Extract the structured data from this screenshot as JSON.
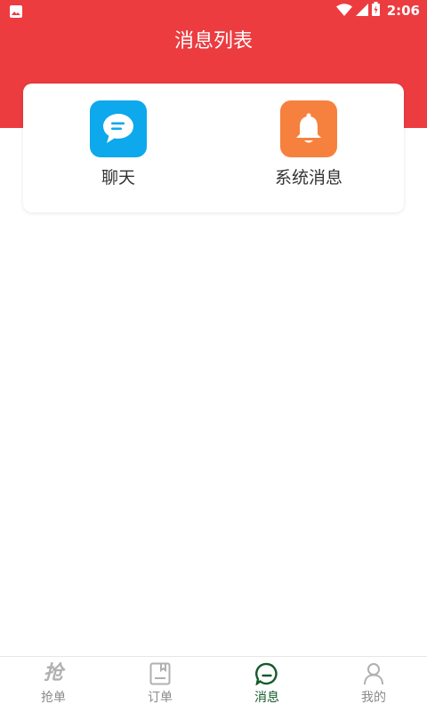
{
  "status_bar": {
    "time": "2:06",
    "left_icon": "image-notification-icon",
    "right_icons": [
      "wifi-icon",
      "cell-signal-icon",
      "battery-charging-icon"
    ]
  },
  "header": {
    "title": "消息列表",
    "background_color": "#ec3c40"
  },
  "entries": [
    {
      "label": "聊天",
      "icon": "chat-bubble-icon",
      "color": "#0ea8ec"
    },
    {
      "label": "系统消息",
      "icon": "bell-icon",
      "color": "#f6813f"
    }
  ],
  "bottom_nav": {
    "items": [
      {
        "label": "抢单",
        "icon": "grab-order-icon",
        "glyph": "抢",
        "active": false
      },
      {
        "label": "订单",
        "icon": "order-icon",
        "active": false
      },
      {
        "label": "消息",
        "icon": "message-icon",
        "active": true
      },
      {
        "label": "我的",
        "icon": "profile-icon",
        "active": false
      }
    ],
    "active_color": "#155a2b",
    "inactive_color": "#8a8a8a"
  }
}
